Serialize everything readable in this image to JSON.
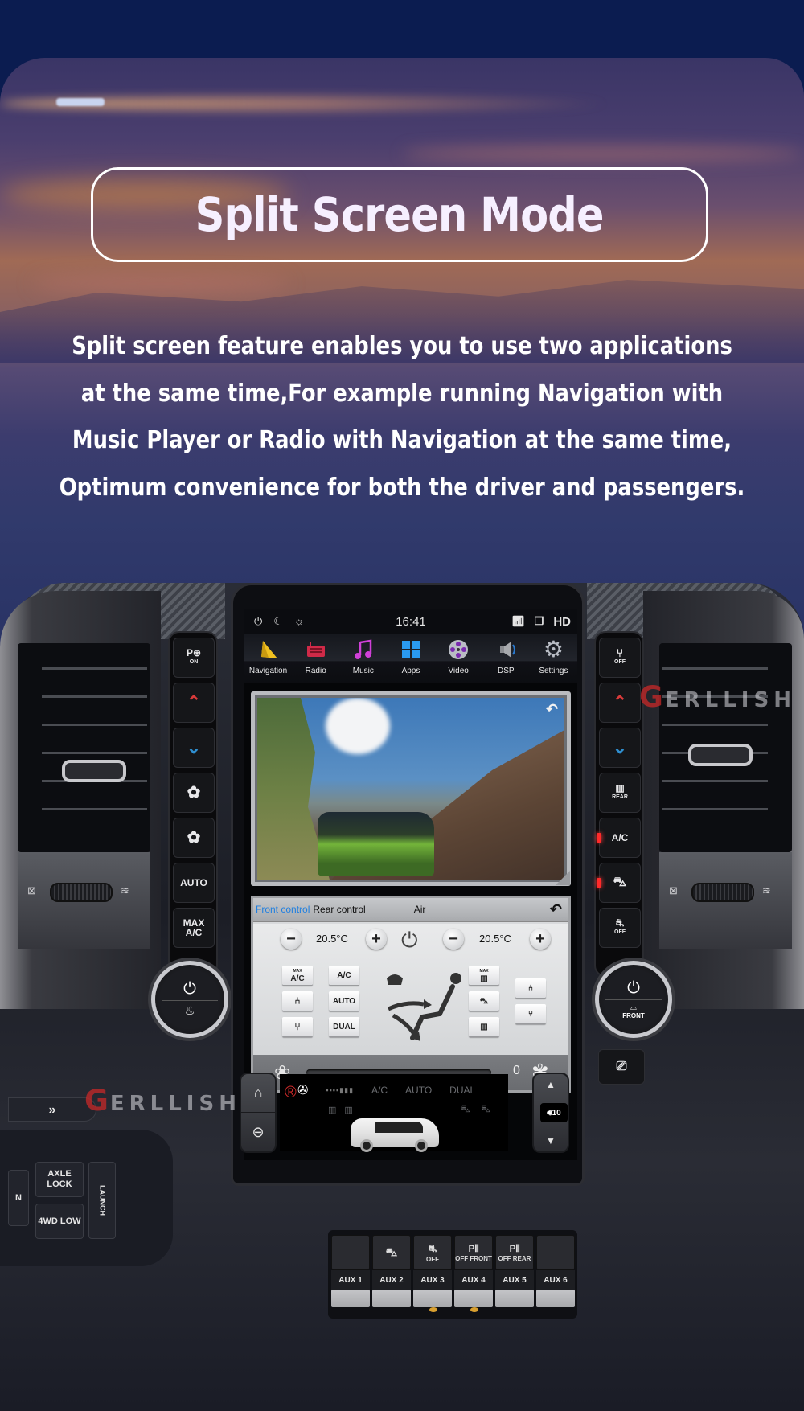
{
  "page": {
    "title": "Split Screen Mode",
    "description_lines": [
      "Split screen feature enables you to use two applications",
      "at the same time,For example running Navigation with",
      "Music Player or Radio with Navigation at the same time,",
      "Optimum convenience for both the driver and passengers."
    ],
    "colors": {
      "background": "#0b1c50",
      "title_text": "#f6efff",
      "accent_blue": "#1f7fe0",
      "brand_red": "#c82828"
    }
  },
  "brand": {
    "watermark": "ERLLISH",
    "watermark_initial": "G",
    "registered_mark": "®"
  },
  "head_unit": {
    "status_bar": {
      "time": "16:41",
      "hd_label": "HD",
      "icons": [
        "power-icon",
        "night-mode-icon",
        "brightness-icon",
        "wifi-icon",
        "multi-window-icon"
      ]
    },
    "apps": [
      {
        "label": "Navigation",
        "icon": "navigation-icon"
      },
      {
        "label": "Radio",
        "icon": "radio-icon"
      },
      {
        "label": "Music",
        "icon": "music-icon"
      },
      {
        "label": "Apps",
        "icon": "apps-grid-icon"
      },
      {
        "label": "Video",
        "icon": "video-reel-icon"
      },
      {
        "label": "DSP",
        "icon": "speaker-icon"
      },
      {
        "label": "Settings",
        "icon": "gear-icon"
      }
    ],
    "video_window": {
      "back_icon": "back-arrow-icon",
      "resize_icon": "resize-icon"
    },
    "climate": {
      "tabs": {
        "front": "Front control",
        "rear": "Rear control"
      },
      "title": "Air",
      "left_temp": "20.5°C",
      "right_temp": "20.5°C",
      "buttons_left": [
        {
          "label": "A/C",
          "sup": "MAX"
        },
        {
          "label": "A/C",
          "sup": ""
        },
        {
          "label": "seat-heat-icon",
          "sup": ""
        },
        {
          "label": "AUTO",
          "sup": ""
        },
        {
          "label": "seat-cool-icon",
          "sup": ""
        },
        {
          "label": "DUAL",
          "sup": ""
        }
      ],
      "buttons_right": [
        "max-defrost-icon",
        "recirculation-icon",
        "rear-defrost-icon"
      ],
      "seat_buttons": [
        "passenger-seat-heat-icon",
        "passenger-seat-cool-icon"
      ],
      "fan_level": "0",
      "fan_level_fraction": 0
    },
    "rear_display": {
      "ac": "A/C",
      "auto": "AUTO",
      "dual": "DUAL",
      "volume": "10"
    }
  },
  "hard_buttons": {
    "left": [
      "P ON",
      "up",
      "down",
      "fan-low",
      "fan-high",
      "AUTO",
      "MAX A/C"
    ],
    "left_park_label": "ON",
    "right": [
      "seat-off",
      "up",
      "down",
      "REAR",
      "A/C",
      "recirculation",
      "OFF"
    ],
    "right_rear_label": "REAR",
    "right_ac_label": "A/C",
    "right_off_label": "OFF",
    "front_knob_label": "FRONT",
    "auto_label": "AUTO",
    "max_label": "MAX",
    "max_ac_label": "A/C"
  },
  "lower_console": {
    "aux": [
      "AUX 1",
      "AUX 2",
      "AUX 3",
      "AUX 4",
      "AUX 5",
      "AUX 6"
    ],
    "aux_top_labels": [
      "",
      "",
      "OFF",
      "OFF FRONT",
      "OFF REAR",
      ""
    ],
    "left_cluster": {
      "axle_lock": "AXLE LOCK",
      "four_wd_low": "4WD LOW",
      "launch": "LAUNCH",
      "neutral": "N"
    }
  }
}
